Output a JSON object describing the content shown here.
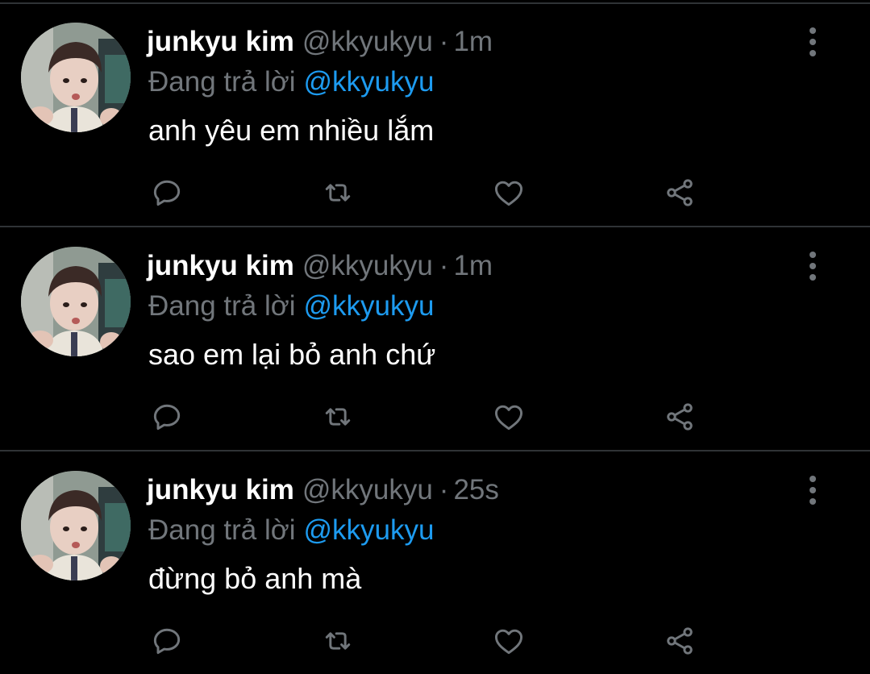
{
  "tweets": [
    {
      "display_name": "junkyu kim",
      "handle": "@kkyukyu",
      "separator": "·",
      "time": "1m",
      "reply_prefix": "Đang trả lời",
      "reply_mention": "@kkyukyu",
      "text": "anh yêu em nhiều lắm",
      "avatar_icon": "profile-photo",
      "actions": [
        "reply-icon",
        "retweet-icon",
        "like-icon",
        "share-icon"
      ],
      "more_icon": "more-vertical-icon"
    },
    {
      "display_name": "junkyu kim",
      "handle": "@kkyukyu",
      "separator": "·",
      "time": "1m",
      "reply_prefix": "Đang trả lời",
      "reply_mention": "@kkyukyu",
      "text": "sao em lại bỏ anh chứ",
      "avatar_icon": "profile-photo",
      "actions": [
        "reply-icon",
        "retweet-icon",
        "like-icon",
        "share-icon"
      ],
      "more_icon": "more-vertical-icon"
    },
    {
      "display_name": "junkyu kim",
      "handle": "@kkyukyu",
      "separator": "·",
      "time": "25s",
      "reply_prefix": "Đang trả lời",
      "reply_mention": "@kkyukyu",
      "text": "đừng bỏ anh mà",
      "avatar_icon": "profile-photo",
      "actions": [
        "reply-icon",
        "retweet-icon",
        "like-icon",
        "share-icon"
      ],
      "more_icon": "more-vertical-icon"
    }
  ],
  "colors": {
    "background": "#000000",
    "primary_text": "#ffffff",
    "secondary_text": "#71767b",
    "mention": "#1d9bf0",
    "divider": "#2f3336"
  }
}
